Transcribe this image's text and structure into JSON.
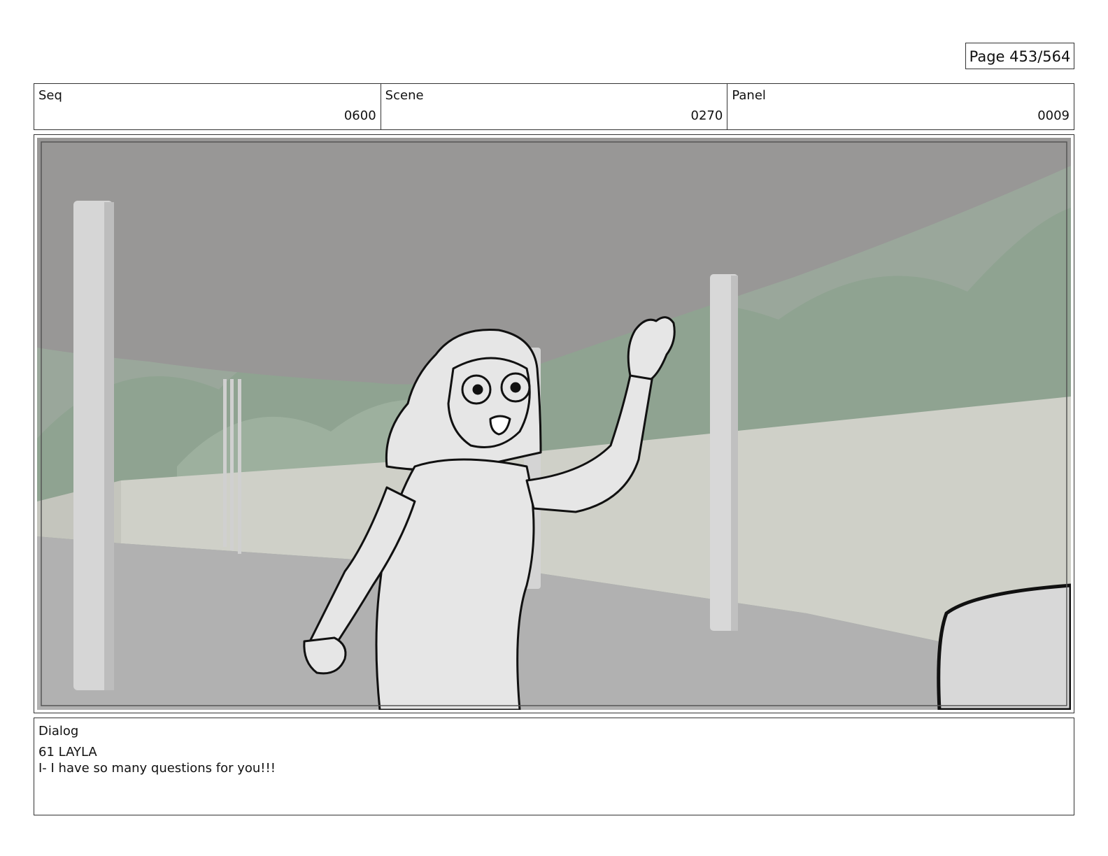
{
  "page": {
    "number_label": "Page 453/564"
  },
  "header": {
    "seq": {
      "label": "Seq",
      "value": "0600"
    },
    "scene": {
      "label": "Scene",
      "value": "0270"
    },
    "panel": {
      "label": "Panel",
      "value": "0009"
    }
  },
  "dialog": {
    "label": "Dialog",
    "speaker": "61 LAYLA",
    "line": "I- I have so many questions for you!!!"
  },
  "colors": {
    "ceiling": "#989796",
    "hills": "#8fa391",
    "wall": "#cfd0c8",
    "floor": "#b1b1b1",
    "sketch_fill": "#e6e6e6",
    "sketch_line": "#111111"
  }
}
